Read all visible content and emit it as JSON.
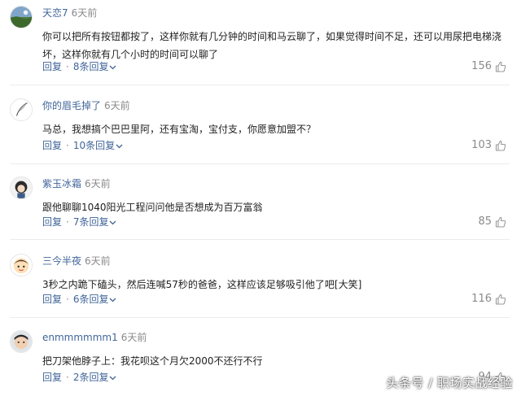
{
  "comments": [
    {
      "username": "天恋7",
      "time": "6天前",
      "text": "你可以把所有按钮都按了，这样你就有几分钟的时间和马云聊了，如果觉得时间不足，还可以用尿把电梯浇坏，这样你就有几个小时的时间可以聊了",
      "reply_label": "回复",
      "separator": "·",
      "replies_label": "8条回复",
      "likes": "156",
      "avatar_icon": "landscape-avatar"
    },
    {
      "username": "你的眉毛掉了",
      "time": "6天前",
      "text": "马总，我想搞个巴巴里阿，还有宝淘，宝付支，你愿意加盟不？",
      "reply_label": "回复",
      "separator": "·",
      "replies_label": "10条回复",
      "likes": "103",
      "avatar_icon": "feather-avatar"
    },
    {
      "username": "紫玉冰霜",
      "time": "6天前",
      "text": "跟他聊聊1040阳光工程问问他是否想成为百万富翁",
      "reply_label": "回复",
      "separator": "·",
      "replies_label": "7条回复",
      "likes": "85",
      "avatar_icon": "character-avatar"
    },
    {
      "username": "三今半夜",
      "time": "6天前",
      "text": "3秒之内跪下磕头，然后连喊57秒的爸爸，这样应该足够吸引他了吧[大笑]",
      "reply_label": "回复",
      "separator": "·",
      "replies_label": "6条回复",
      "likes": "116",
      "avatar_icon": "cartoon-avatar"
    },
    {
      "username": "enmmmmmm1",
      "time": "6天前",
      "text": "把刀架他脖子上：我花呗这个月欠2000不还行不行",
      "reply_label": "回复",
      "separator": "·",
      "replies_label": "2条回复",
      "likes": "94",
      "avatar_icon": "face-avatar"
    }
  ],
  "watermark": "头条号 / 职场实战经验",
  "colors": {
    "link": "#406599",
    "meta": "#8a8a8a",
    "text": "#222222",
    "divider": "#ececec"
  }
}
